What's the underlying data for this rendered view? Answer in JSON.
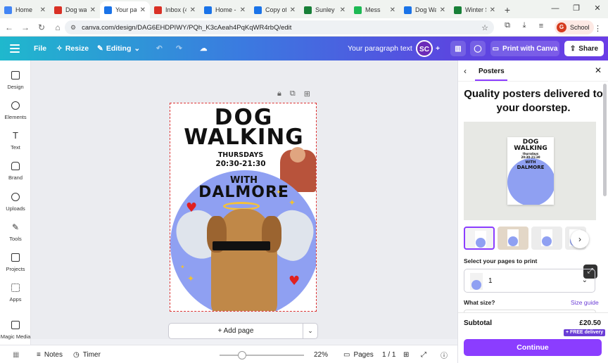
{
  "browser": {
    "tabs": [
      {
        "title": "Home",
        "color": "#4285f4"
      },
      {
        "title": "Dog wal",
        "color": "#d93025"
      },
      {
        "title": "Your pa",
        "color": "#1a73e8",
        "active": true
      },
      {
        "title": "Inbox (4",
        "color": "#d93025"
      },
      {
        "title": "Home -",
        "color": "#1a73e8"
      },
      {
        "title": "Copy of",
        "color": "#1a73e8"
      },
      {
        "title": "Sunley D",
        "color": "#188038"
      },
      {
        "title": "Mess",
        "color": "#1db954"
      },
      {
        "title": "Dog Wa",
        "color": "#1a73e8"
      },
      {
        "title": "Winter S",
        "color": "#188038"
      }
    ],
    "url": "canva.com/design/DAG6EHDPIWY/PQh_K3cAeah4PqKqWR4rbQ/edit",
    "profile_label": "School",
    "profile_initial": "G"
  },
  "header": {
    "file": "File",
    "resize": "Resize",
    "editing": "Editing",
    "doc_title": "Your paragraph text",
    "avatar_initials": "SC",
    "print": "Print with Canva",
    "share": "Share"
  },
  "sidebar": {
    "items": [
      {
        "label": "Design"
      },
      {
        "label": "Elements"
      },
      {
        "label": "Text"
      },
      {
        "label": "Brand"
      },
      {
        "label": "Uploads"
      },
      {
        "label": "Tools"
      },
      {
        "label": "Projects"
      },
      {
        "label": "Apps"
      },
      {
        "label": "Magic Media"
      }
    ]
  },
  "poster": {
    "line1": "DOG",
    "line2": "WALKING",
    "day": "THURSDAYS",
    "time": "20:30-21:30",
    "with": "WITH",
    "name": "DALMORE"
  },
  "canvas": {
    "add_page": "+ Add page"
  },
  "bottom": {
    "notes": "Notes",
    "timer": "Timer",
    "zoom": "22%",
    "pages": "Pages",
    "page_count": "1 / 1",
    "zoom_fraction": 0.22
  },
  "panel": {
    "title": "Posters",
    "headline": "Quality posters delivered to your doorstep.",
    "select_pages_label": "Select your pages to print",
    "selected_pages": "1",
    "size_label": "What size?",
    "size_guide": "Size guide",
    "subtotal_label": "Subtotal",
    "subtotal_value": "£20.50",
    "free_delivery": "+ FREE delivery",
    "continue": "Continue",
    "mini_title1": "DOG",
    "mini_title2": "WALKING",
    "mini_subtitle": "thursdays",
    "mini_time": "20:30-21:30",
    "mini_with": "WITH",
    "mini_name": "DALMORE"
  },
  "colors": {
    "accent": "#8b3dff",
    "poster_blob": "#8fa0f2"
  }
}
